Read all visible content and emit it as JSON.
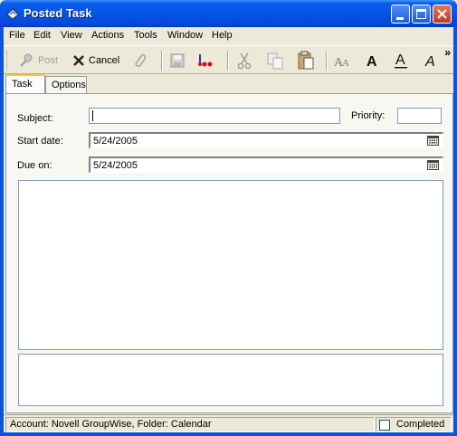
{
  "window": {
    "title": "Posted Task"
  },
  "menu": [
    "File",
    "Edit",
    "View",
    "Actions",
    "Tools",
    "Window",
    "Help"
  ],
  "toolbar": {
    "post_label": "Post",
    "cancel_label": "Cancel"
  },
  "tabs": [
    {
      "label": "Task",
      "active": true
    },
    {
      "label": "Options",
      "active": false
    }
  ],
  "form": {
    "subject_label": "Subject:",
    "subject_value": "",
    "priority_label": "Priority:",
    "priority_value": "",
    "start_label": "Start date:",
    "start_value": "5/24/2005",
    "due_label": "Due on:",
    "due_value": "5/24/2005"
  },
  "status": {
    "location": "Account: Novell GroupWise,  Folder: Calendar",
    "completed_label": "Completed",
    "completed_checked": false
  },
  "colors": {
    "title_bar": "#0a5be9",
    "close_button": "#c6381b",
    "tab_highlight": "#ffc83c",
    "chrome": "#ece9d8"
  }
}
